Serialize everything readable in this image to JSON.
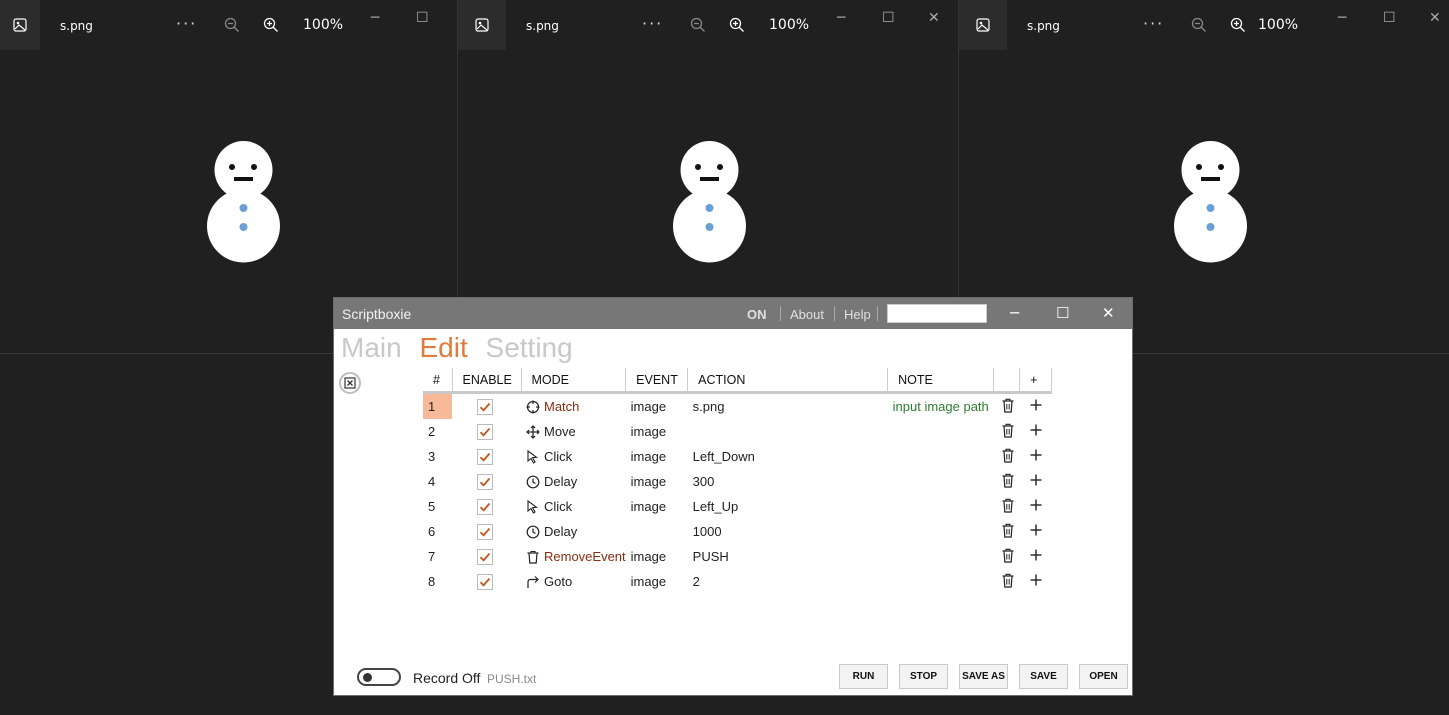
{
  "viewers": [
    {
      "filename": "s.png",
      "menu": "···",
      "zoom": "100%"
    },
    {
      "filename": "s.png",
      "menu": "···",
      "zoom": "100%"
    },
    {
      "filename": "s.png",
      "menu": "···",
      "zoom": "100%"
    }
  ],
  "app": {
    "title": "Scriptboxie",
    "status": "ON",
    "menu": [
      "About",
      "Help"
    ],
    "search_value": ""
  },
  "tabs": [
    "Main",
    "Edit",
    "Setting"
  ],
  "active_tab": "Edit",
  "table": {
    "headers": [
      "#",
      "ENABLE",
      "MODE",
      "EVENT",
      "ACTION",
      "NOTE",
      "",
      "+"
    ],
    "rows": [
      {
        "num": "1",
        "enabled": true,
        "mode_icon": "crosshair-icon",
        "mode": "Match",
        "event": "image",
        "action": "s.png",
        "note": "input image path",
        "selected": true
      },
      {
        "num": "2",
        "enabled": true,
        "mode_icon": "move-icon",
        "mode": "Move",
        "event": "image",
        "action": "",
        "note": ""
      },
      {
        "num": "3",
        "enabled": true,
        "mode_icon": "cursor-icon",
        "mode": "Click",
        "event": "image",
        "action": "Left_Down",
        "note": ""
      },
      {
        "num": "4",
        "enabled": true,
        "mode_icon": "clock-icon",
        "mode": "Delay",
        "event": "image",
        "action": "300",
        "note": ""
      },
      {
        "num": "5",
        "enabled": true,
        "mode_icon": "cursor-icon",
        "mode": "Click",
        "event": "image",
        "action": "Left_Up",
        "note": ""
      },
      {
        "num": "6",
        "enabled": true,
        "mode_icon": "clock-icon",
        "mode": "Delay",
        "event": "",
        "action": "1000",
        "note": ""
      },
      {
        "num": "7",
        "enabled": true,
        "mode_icon": "trash-icon",
        "mode": "RemoveEvent",
        "event": "image",
        "action": "PUSH",
        "note": ""
      },
      {
        "num": "8",
        "enabled": true,
        "mode_icon": "redo-arrow-icon",
        "mode": "Goto",
        "event": "image",
        "action": "2",
        "note": ""
      }
    ]
  },
  "footer": {
    "record_label": "Record Off",
    "file": "PUSH.txt",
    "buttons": [
      "RUN",
      "STOP",
      "SAVE AS",
      "SAVE",
      "OPEN"
    ]
  },
  "colors": {
    "accent": "#e07b3c",
    "selected_row": "#f7b998",
    "check": "#c0561a"
  }
}
